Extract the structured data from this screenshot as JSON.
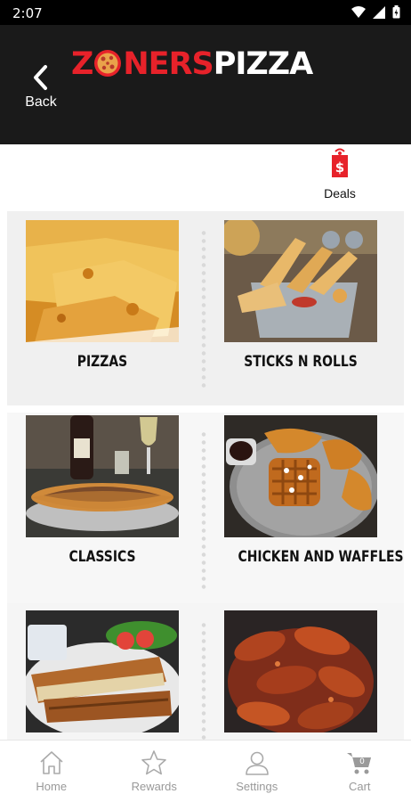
{
  "status_bar": {
    "time": "2:07"
  },
  "header": {
    "back_label": "Back",
    "logo": {
      "part1": "Z",
      "part2": "NERS",
      "part3": "PIZZA"
    }
  },
  "deals": {
    "label": "Deals"
  },
  "categories": [
    {
      "label": "PIZZAS"
    },
    {
      "label": "STICKS N ROLLS"
    },
    {
      "label": "CLASSICS"
    },
    {
      "label": "CHICKEN AND WAFFLES"
    },
    {
      "label": ""
    },
    {
      "label": ""
    }
  ],
  "bottom_nav": [
    {
      "label": "Home",
      "icon": "home-icon"
    },
    {
      "label": "Rewards",
      "icon": "star-icon"
    },
    {
      "label": "Settings",
      "icon": "person-icon"
    },
    {
      "label": "Cart",
      "icon": "cart-icon",
      "badge": "0"
    }
  ],
  "colors": {
    "brand_red": "#e7222a",
    "header_bg": "#1a1a1a",
    "nav_grey": "#999999"
  }
}
